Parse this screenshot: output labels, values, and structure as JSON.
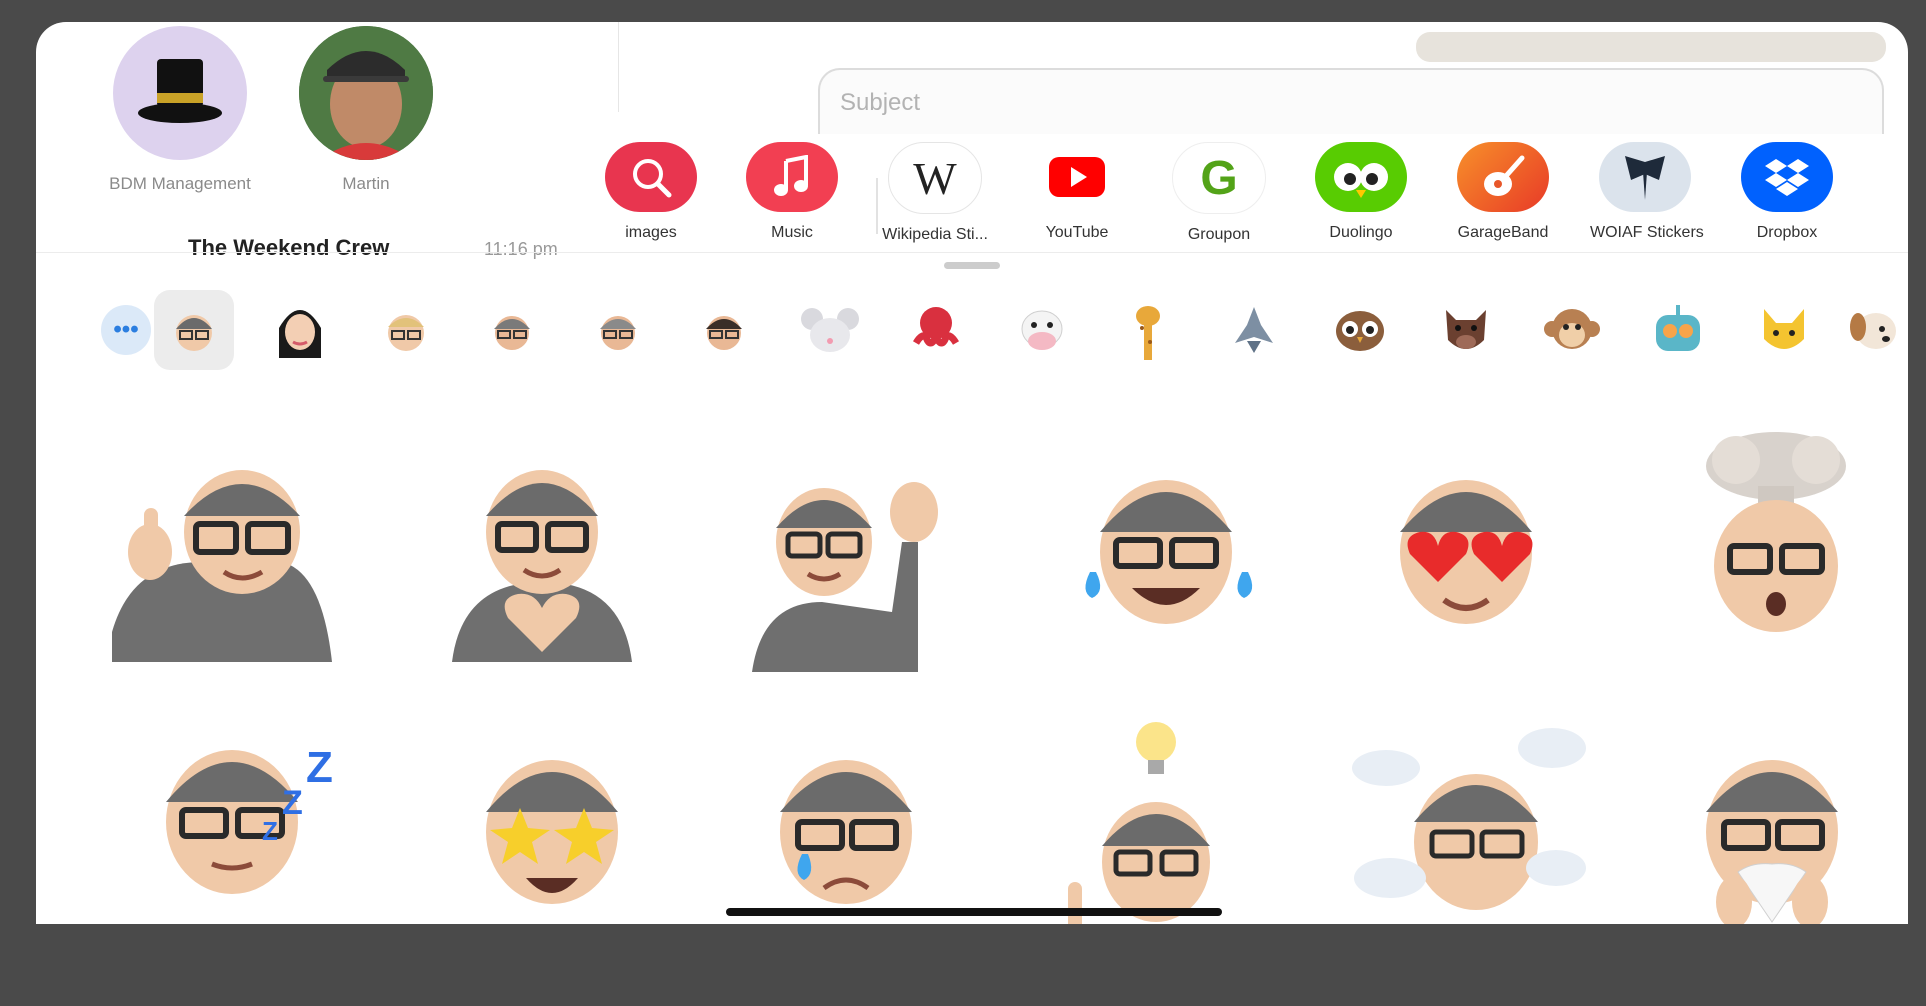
{
  "pinned_conversations": [
    {
      "name": "BDM Management",
      "avatar": "top-hat-icon"
    },
    {
      "name": "Martin",
      "avatar": "person-photo"
    }
  ],
  "conversation_preview": {
    "title": "The Weekend Crew",
    "time": "11:16 pm"
  },
  "compose": {
    "subject_placeholder": "Subject"
  },
  "app_drawer": {
    "apps": [
      {
        "label": "images",
        "icon": "image-search-icon",
        "color": "#e8354f"
      },
      {
        "label": "Music",
        "icon": "music-note-icon",
        "color": "#f23f52"
      },
      {
        "label": "Wikipedia Sti...",
        "icon": "wikipedia-w-icon",
        "color": "#ffffff"
      },
      {
        "label": "YouTube",
        "icon": "youtube-play-icon",
        "color": "#ff0000"
      },
      {
        "label": "Groupon",
        "icon": "groupon-g-icon",
        "color": "#53a318"
      },
      {
        "label": "Duolingo",
        "icon": "duolingo-owl-icon",
        "color": "#58cc02"
      },
      {
        "label": "GarageBand",
        "icon": "guitar-icon",
        "color": "#f25c22"
      },
      {
        "label": "WOIAF Stickers",
        "icon": "dragon-icon",
        "color": "#dbe3ec"
      },
      {
        "label": "Dropbox",
        "icon": "dropbox-icon",
        "color": "#0061fe"
      }
    ]
  },
  "memoji_selector": {
    "more_label": "•••",
    "items": [
      "memoji-grey-beanie-glasses",
      "memoji-woman-black-hair",
      "memoji-blonde-glasses",
      "memoji-grey-hat",
      "memoji-grey-hat-2",
      "memoji-dark-hair-glasses",
      "mouse-icon",
      "octopus-icon",
      "cow-icon",
      "giraffe-icon",
      "shark-icon",
      "owl-icon",
      "boar-icon",
      "monkey-icon",
      "robot-icon",
      "cat-icon",
      "dog-icon"
    ]
  },
  "stickers": [
    "thumbs-up",
    "heart-hands",
    "waving",
    "tears-of-joy",
    "heart-eyes",
    "mind-blown",
    "sleeping",
    "star-struck",
    "sad-tear",
    "idea",
    "head-in-clouds",
    "sneezing"
  ]
}
